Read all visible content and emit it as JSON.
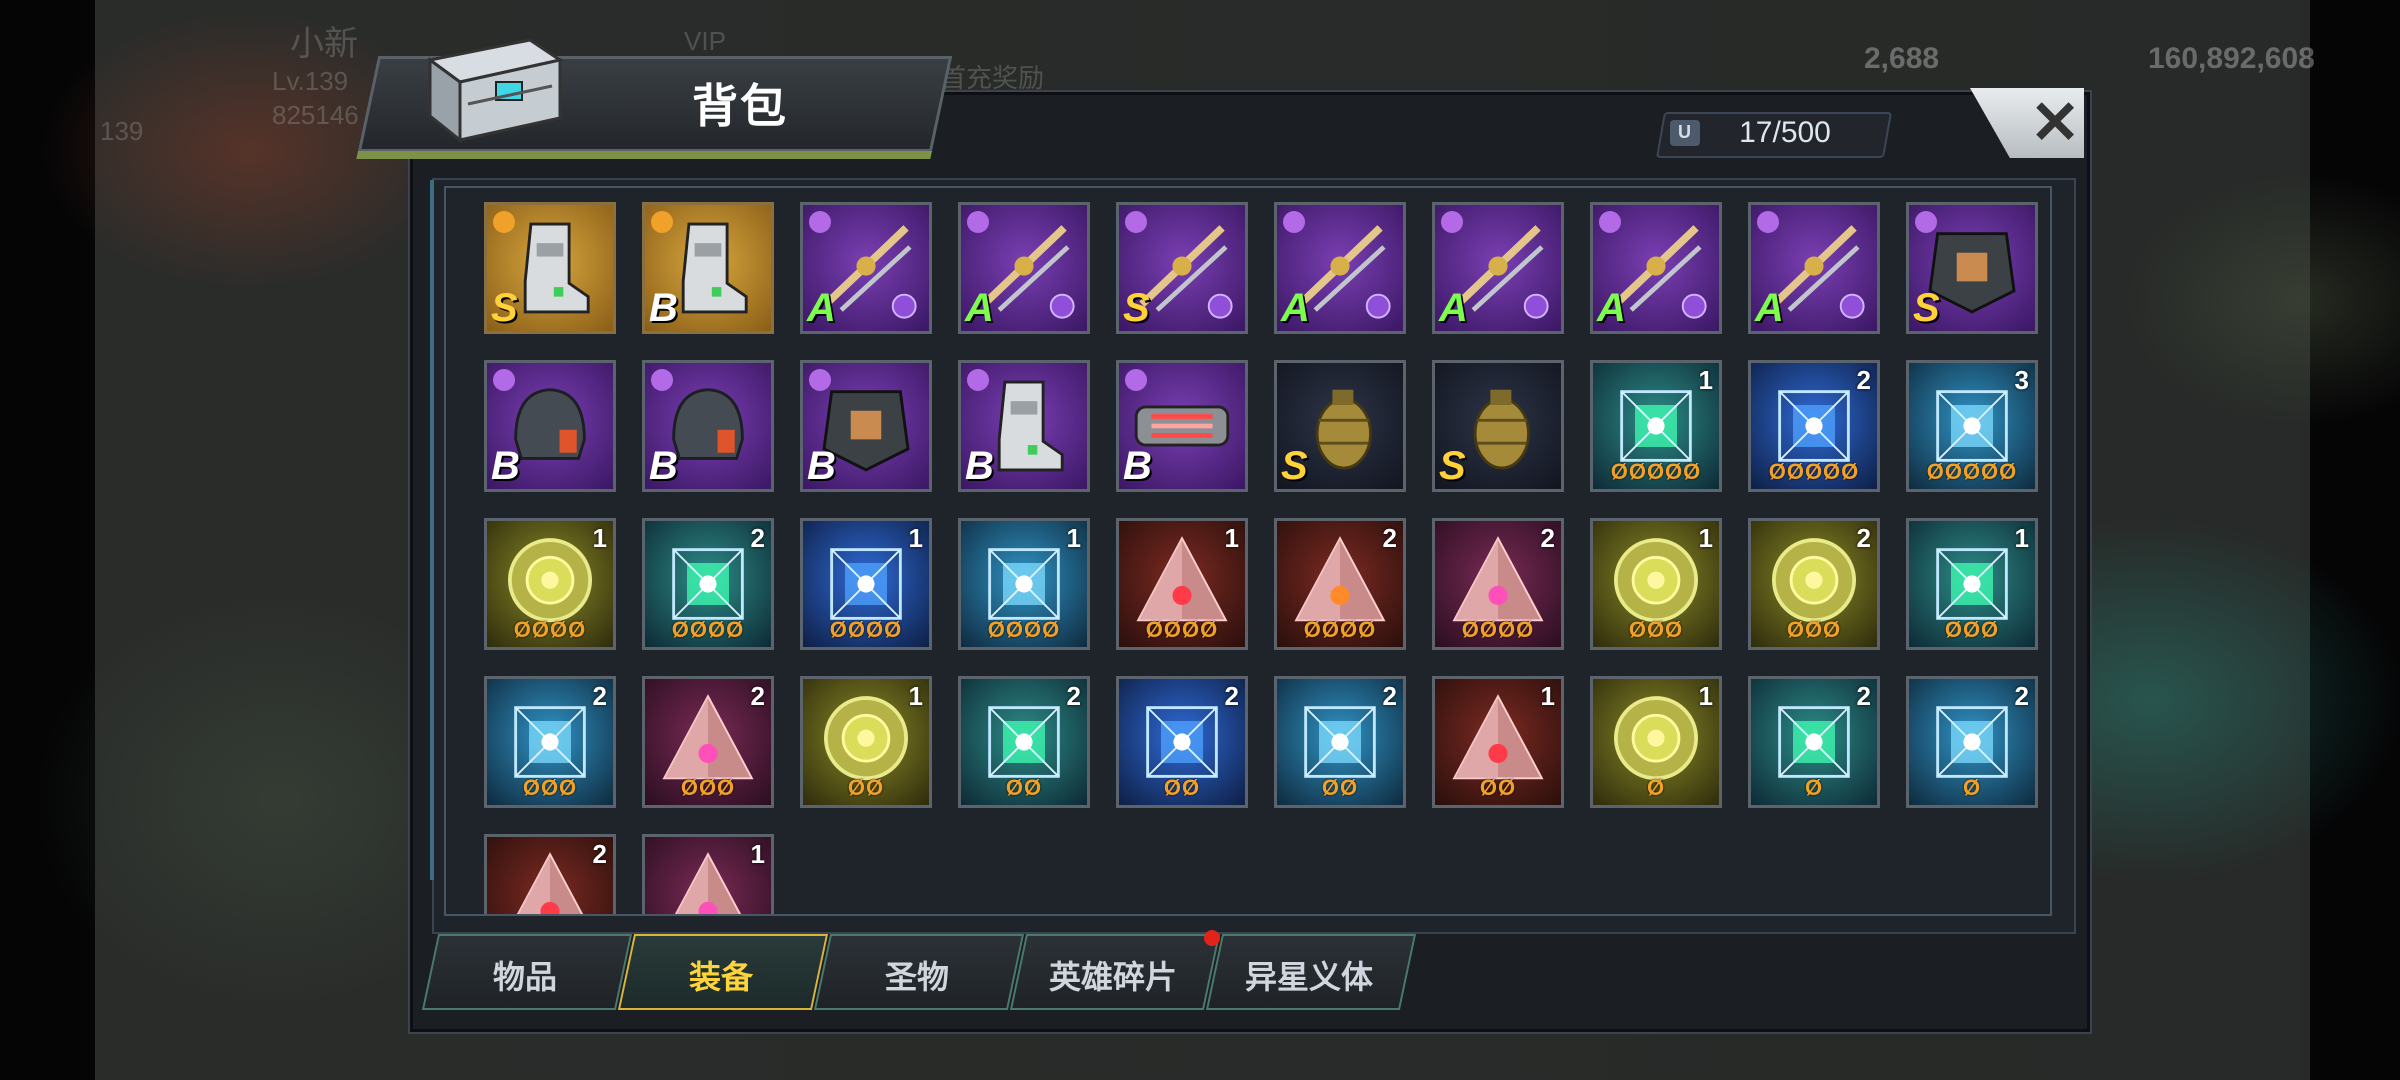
{
  "window": {
    "title": "背包",
    "capacity": "17/500",
    "close_icon": "close-icon"
  },
  "background_hud": {
    "player_name": "小新",
    "player_level": "Lv.139",
    "player_id": "825146",
    "level_badge": "139",
    "vip_label": "VIP",
    "first_recharge": "首充奖励",
    "currency_a": "2,688",
    "currency_b": "160,892,608"
  },
  "colors": {
    "legendary_bg": "#b9862c",
    "epic_bg": "#5a2c8e",
    "rare_bg": "#233d5a",
    "accent_gold": "#ffd43a",
    "star_orange": "#f0a12a",
    "tab_border": "#4a7a6c"
  },
  "inventory": [
    {
      "icon": "boots-icon",
      "bg": "gold",
      "grade": "S",
      "grade_color": "#ffd23a",
      "tag": "gold"
    },
    {
      "icon": "boots-icon",
      "bg": "gold",
      "grade": "B",
      "grade_color": "#ffffff",
      "tag": "gold"
    },
    {
      "icon": "twin-blades-icon",
      "bg": "purple",
      "grade": "A",
      "grade_color": "#7dfc4f",
      "tag": "purple-corner"
    },
    {
      "icon": "rifle-icon",
      "bg": "purple",
      "grade": "A",
      "grade_color": "#7dfc4f",
      "tag": "purple-corner"
    },
    {
      "icon": "claw-gun-icon",
      "bg": "purple",
      "grade": "S",
      "grade_color": "#ffd23a",
      "tag": "purple-corner"
    },
    {
      "icon": "bow-icon",
      "bg": "purple",
      "grade": "A",
      "grade_color": "#7dfc4f",
      "tag": "purple-corner"
    },
    {
      "icon": "katana-icon",
      "bg": "purple",
      "grade": "A",
      "grade_color": "#7dfc4f",
      "tag": "purple-corner"
    },
    {
      "icon": "arrows-icon",
      "bg": "purple",
      "grade": "A",
      "grade_color": "#7dfc4f",
      "tag": "purple-corner"
    },
    {
      "icon": "gatling-icon",
      "bg": "purple",
      "grade": "A",
      "grade_color": "#7dfc4f",
      "tag": "purple-corner"
    },
    {
      "icon": "armor-icon",
      "bg": "purple",
      "grade": "S",
      "grade_color": "#ffd23a",
      "tag": "purple"
    },
    {
      "icon": "helmet-icon",
      "bg": "purple",
      "grade": "B",
      "grade_color": "#ffffff",
      "tag": "purple"
    },
    {
      "icon": "helmet-icon",
      "bg": "purple",
      "grade": "B",
      "grade_color": "#ffffff",
      "tag": "purple"
    },
    {
      "icon": "armor-icon",
      "bg": "purple",
      "grade": "B",
      "grade_color": "#ffffff",
      "tag": "purple"
    },
    {
      "icon": "boots-icon",
      "bg": "purple",
      "grade": "B",
      "grade_color": "#ffffff",
      "tag": "purple"
    },
    {
      "icon": "gloves-icon",
      "bg": "purple",
      "grade": "B",
      "grade_color": "#ffffff",
      "tag": "purple"
    },
    {
      "icon": "grenade-icon",
      "bg": "navy",
      "grade": "S",
      "grade_color": "#ffd23a"
    },
    {
      "icon": "grenade-icon",
      "bg": "navy",
      "grade": "S",
      "grade_color": "#ffd23a"
    },
    {
      "icon": "teal-chip-icon",
      "bg": "teal",
      "count": "1",
      "stars": "ØØØØØ"
    },
    {
      "icon": "blue-chip-icon",
      "bg": "blue",
      "count": "2",
      "stars": "ØØØØØ"
    },
    {
      "icon": "cyan-chip-icon",
      "bg": "cyan",
      "count": "3",
      "stars": "ØØØØØ"
    },
    {
      "icon": "gold-gear-icon",
      "bg": "olive",
      "count": "1",
      "stars": "ØØØØ"
    },
    {
      "icon": "teal-chip-icon",
      "bg": "teal",
      "count": "2",
      "stars": "ØØØØ"
    },
    {
      "icon": "blue-chip-icon",
      "bg": "blue",
      "count": "1",
      "stars": "ØØØØ"
    },
    {
      "icon": "cyan-chip-icon",
      "bg": "cyan",
      "count": "1",
      "stars": "ØØØØ"
    },
    {
      "icon": "red-pyramid-icon",
      "bg": "red",
      "count": "1",
      "stars": "ØØØØ"
    },
    {
      "icon": "orange-pyramid-icon",
      "bg": "red",
      "count": "2",
      "stars": "ØØØØ"
    },
    {
      "icon": "pink-pyramid-icon",
      "bg": "pink",
      "count": "2",
      "stars": "ØØØØ"
    },
    {
      "icon": "gold-gear-icon",
      "bg": "olive",
      "count": "1",
      "stars": "ØØØ"
    },
    {
      "icon": "gold-gear-icon",
      "bg": "olive",
      "count": "2",
      "stars": "ØØØ"
    },
    {
      "icon": "teal-chip-icon",
      "bg": "teal",
      "count": "1",
      "stars": "ØØØ"
    },
    {
      "icon": "cyan-chip-icon",
      "bg": "cyan",
      "count": "2",
      "stars": "ØØØ"
    },
    {
      "icon": "pink-pyramid-icon",
      "bg": "pink",
      "count": "2",
      "stars": "ØØØ"
    },
    {
      "icon": "gold-gear-icon",
      "bg": "olive",
      "count": "1",
      "stars": "ØØ"
    },
    {
      "icon": "teal-chip-icon",
      "bg": "teal",
      "count": "2",
      "stars": "ØØ"
    },
    {
      "icon": "blue-chip-icon",
      "bg": "blue",
      "count": "2",
      "stars": "ØØ"
    },
    {
      "icon": "cyan-chip-icon",
      "bg": "cyan",
      "count": "2",
      "stars": "ØØ"
    },
    {
      "icon": "red-pyramid-icon",
      "bg": "red",
      "count": "1",
      "stars": "ØØ"
    },
    {
      "icon": "gold-gear-icon",
      "bg": "olive",
      "count": "1",
      "stars": "Ø"
    },
    {
      "icon": "teal-chip-icon",
      "bg": "teal",
      "count": "2",
      "stars": "Ø"
    },
    {
      "icon": "cyan-chip-icon",
      "bg": "cyan",
      "count": "2",
      "stars": "Ø"
    },
    {
      "icon": "red-pyramid-icon",
      "bg": "red",
      "count": "2"
    },
    {
      "icon": "pink-pyramid-icon",
      "bg": "pink",
      "count": "1"
    }
  ],
  "tabs": [
    {
      "label": "物品",
      "active": false
    },
    {
      "label": "装备",
      "active": true
    },
    {
      "label": "圣物",
      "active": false
    },
    {
      "label": "英雄碎片",
      "active": false,
      "badge": true
    },
    {
      "label": "异星义体",
      "active": false
    }
  ]
}
